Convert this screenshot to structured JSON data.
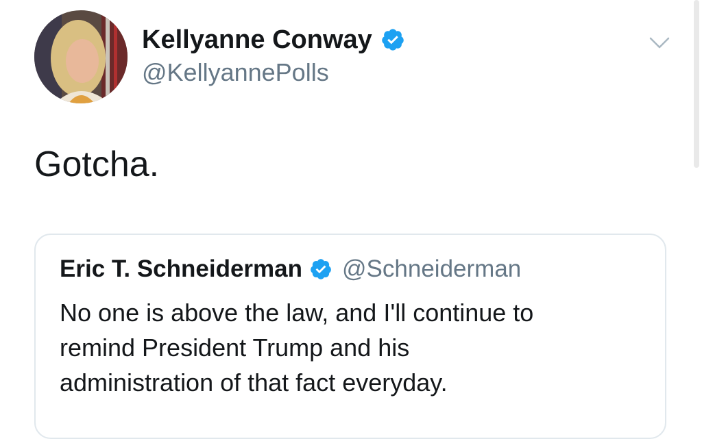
{
  "author": {
    "name": "Kellyanne Conway",
    "handle": "@KellyannePolls",
    "verified_icon": "verified-badge-icon",
    "avatar_icon": "avatar-photo"
  },
  "tweet": {
    "text": "Gotcha."
  },
  "menu": {
    "icon": "chevron-down-icon"
  },
  "quoted_tweet": {
    "name": "Eric T. Schneiderman",
    "handle": "@Schneiderman",
    "verified_icon": "verified-badge-icon",
    "text_lines": [
      "No one is above the law, and I'll continue to",
      "remind President Trump and his",
      "administration of that fact everyday."
    ]
  },
  "colors": {
    "verified_blue": "#1da1f2",
    "text_primary": "#14171a",
    "text_secondary": "#657786",
    "card_border": "#e1e8ed"
  }
}
